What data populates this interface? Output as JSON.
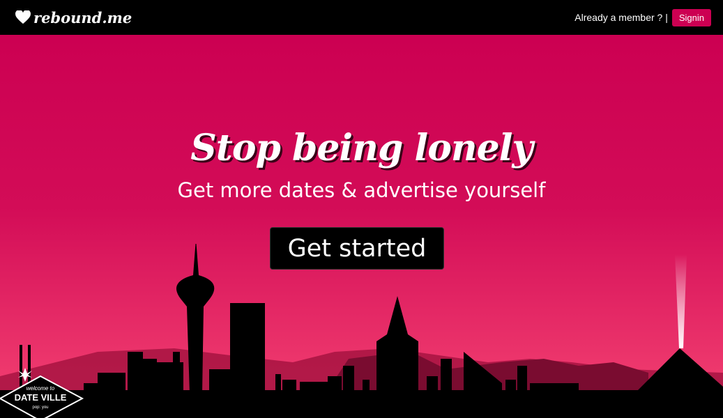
{
  "brand": {
    "name": "rebound.me"
  },
  "nav": {
    "member_text": "Already a member ? |",
    "signin_label": "Signin"
  },
  "hero": {
    "title": "Stop being lonely",
    "subtitle": "Get more dates & advertise yourself",
    "cta_label": "Get started"
  },
  "sign": {
    "line1": "welcome to",
    "line2": "DATE VILLE",
    "line3": "pop: you"
  },
  "colors": {
    "accent": "#cc0052",
    "nav": "#000000"
  }
}
